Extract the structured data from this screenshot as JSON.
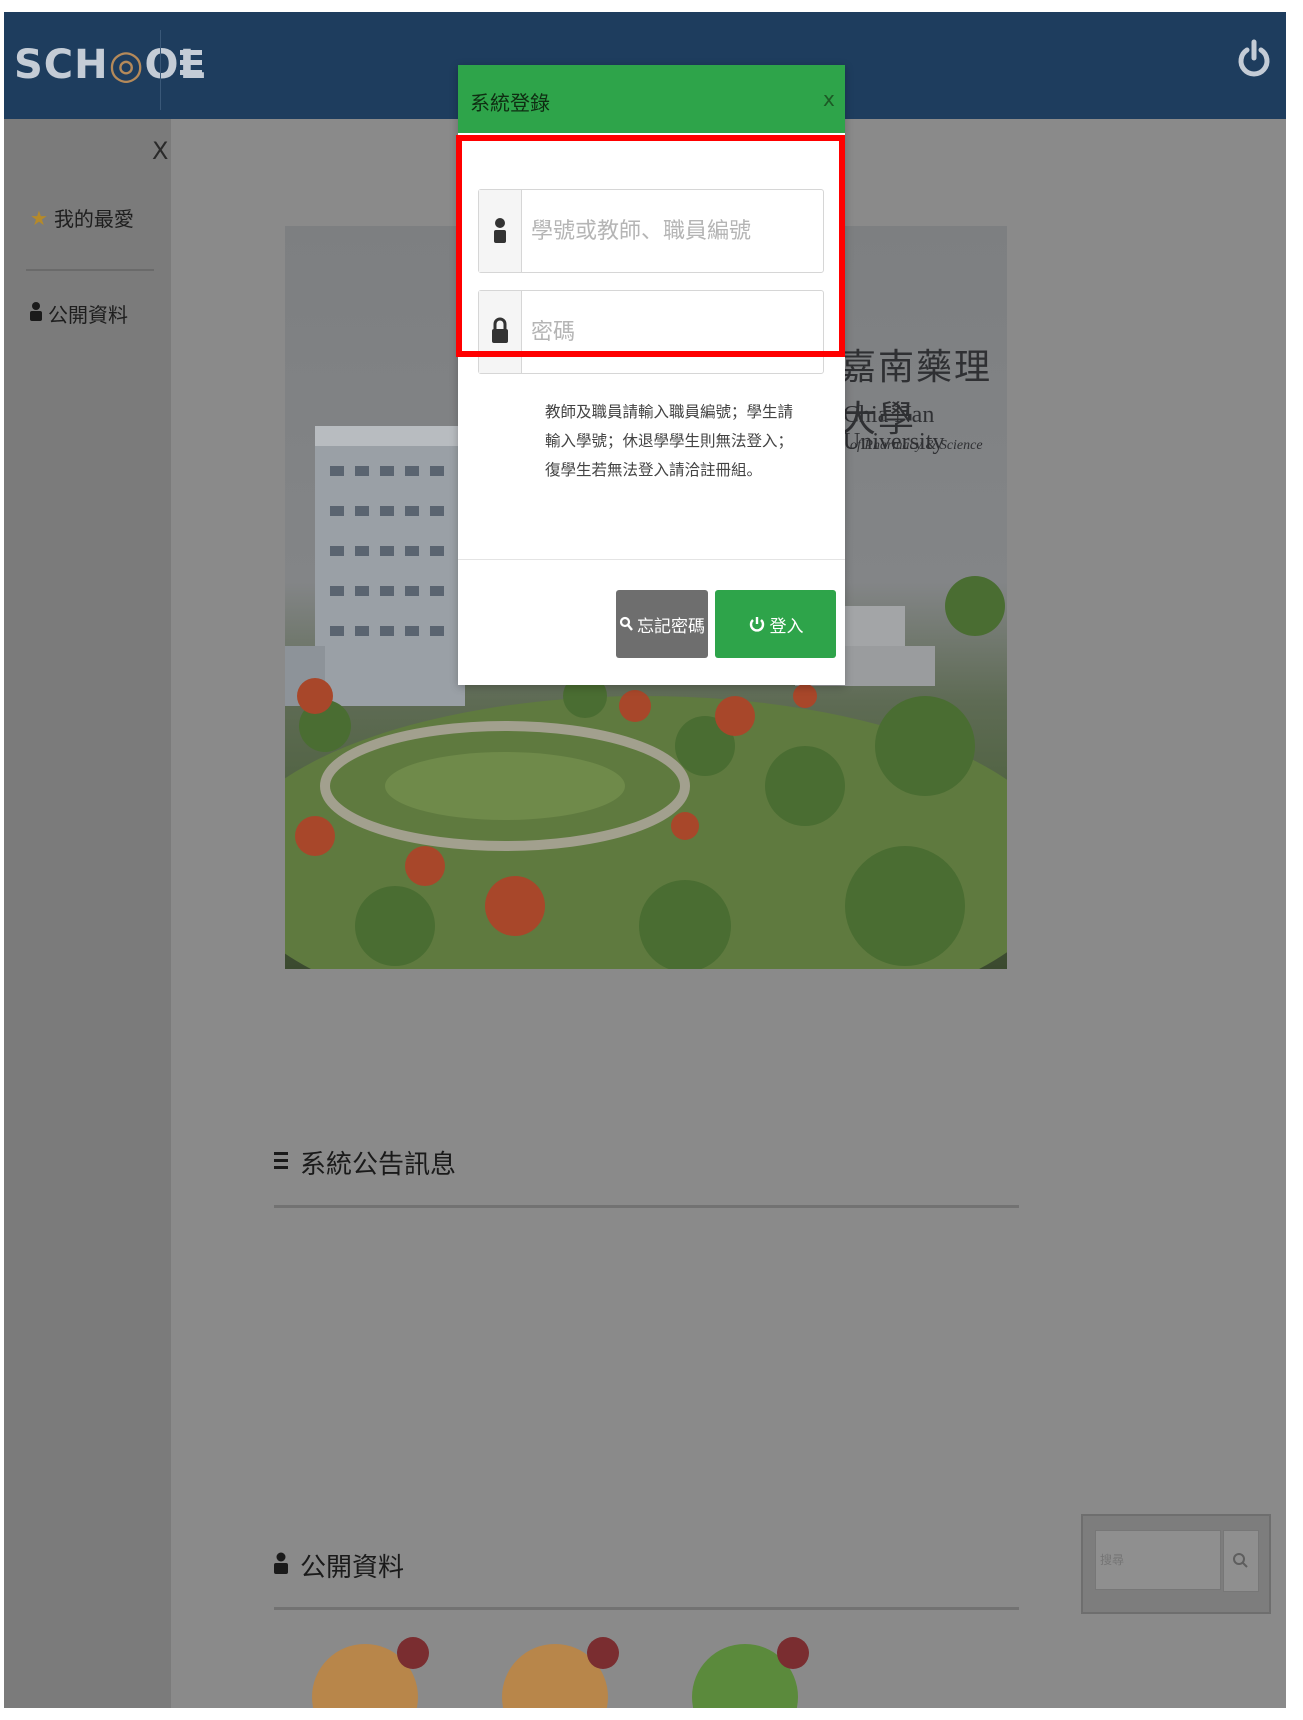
{
  "navbar": {
    "logo_text_a": "SCH",
    "logo_text_o": "◎",
    "logo_text_b": "OL"
  },
  "sidebar": {
    "close_label": "X",
    "items": [
      {
        "label": "我的最愛",
        "icon": "star-icon"
      },
      {
        "label": "公開資料",
        "icon": "user-icon"
      }
    ]
  },
  "hero": {
    "title": "嘉南藥理大學",
    "subtitle1": "Chia Nan University",
    "subtitle2": "of Pharmacy & Science"
  },
  "announcements": {
    "title": "系統公告訊息"
  },
  "public_data": {
    "title": "公開資料"
  },
  "search": {
    "placeholder": "搜尋"
  },
  "modal": {
    "title": "系統登錄",
    "close_label": "x",
    "username_placeholder": "學號或教師、職員編號",
    "password_placeholder": "密碼",
    "notice": "教師及職員請輸入職員編號；學生請輸入學號；休退學學生則無法登入；復學生若無法登入請洽註冊組。",
    "forgot_button": "忘記密碼",
    "login_button": "登入"
  },
  "colors": {
    "navbar": "#1e3d5e",
    "modal_header": "#2ea44a",
    "login_button": "#2ea44a",
    "highlight_frame": "#ff0000"
  }
}
